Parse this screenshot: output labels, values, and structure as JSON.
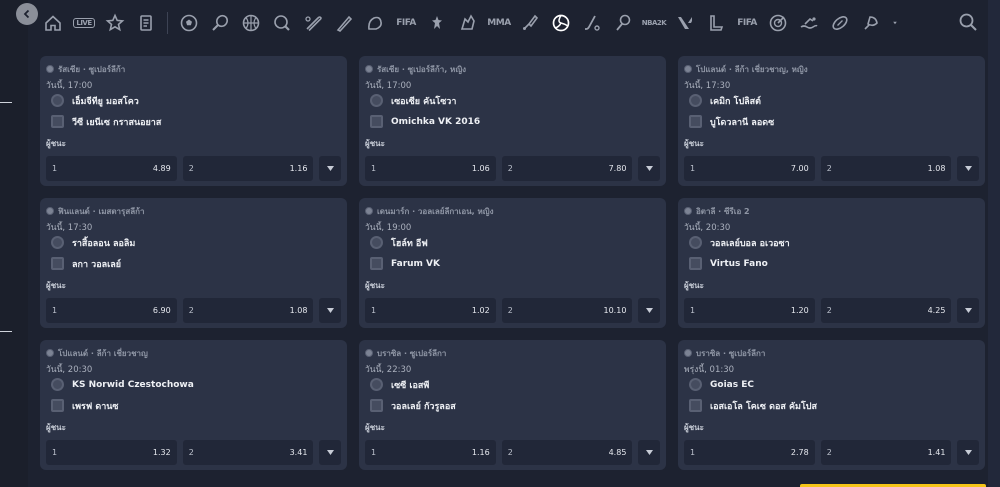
{
  "nav": {
    "sports": [
      {
        "name": "home-icon",
        "type": "svg"
      },
      {
        "name": "live-icon",
        "type": "text",
        "text": "LIVE"
      },
      {
        "name": "star-icon",
        "type": "svg"
      },
      {
        "name": "betslip-icon",
        "type": "svg"
      },
      {
        "name": "separator"
      },
      {
        "name": "soccer-icon",
        "type": "svg"
      },
      {
        "name": "tennis-icon",
        "type": "svg"
      },
      {
        "name": "basketball-icon",
        "type": "svg"
      },
      {
        "name": "pingpong-icon",
        "type": "svg"
      },
      {
        "name": "baseball-icon",
        "type": "svg"
      },
      {
        "name": "cricket-icon",
        "type": "svg"
      },
      {
        "name": "esports-icon",
        "type": "svg"
      },
      {
        "name": "fifa-icon",
        "type": "text",
        "text": "FIFA"
      },
      {
        "name": "counter-strike-icon",
        "type": "svg"
      },
      {
        "name": "dota-icon",
        "type": "svg"
      },
      {
        "name": "mma-icon",
        "type": "text",
        "text": "MMA"
      },
      {
        "name": "badminton-icon",
        "type": "svg"
      },
      {
        "name": "volleyball-icon",
        "type": "svg",
        "active": true
      },
      {
        "name": "hockey-icon",
        "type": "svg"
      },
      {
        "name": "handball-icon",
        "type": "svg"
      },
      {
        "name": "nba2k-icon",
        "type": "text",
        "text": "NBA2K"
      },
      {
        "name": "valorant-icon",
        "type": "svg"
      },
      {
        "name": "league-of-legends-icon",
        "type": "svg"
      },
      {
        "name": "volta-fifa-icon",
        "type": "text",
        "text": "FIFA"
      },
      {
        "name": "darts-icon",
        "type": "svg"
      },
      {
        "name": "swimming-icon",
        "type": "svg"
      },
      {
        "name": "rugby-icon",
        "type": "svg"
      },
      {
        "name": "more-sports-icon",
        "type": "svg"
      },
      {
        "name": "dropdown-caret-icon",
        "type": "svg"
      }
    ]
  },
  "matches": [
    {
      "league": "รัสเซีย · ซูเปอร์ลีก้า",
      "date": "วันนี้, 17:00",
      "team1": "เอ็มจีทียู มอสโคว",
      "team2": "วีซี เยนีเซ กราสนอยาส",
      "winner_label": "ผู้ชนะ",
      "odd1_label": "1",
      "odd1": "4.89",
      "odd2_label": "2",
      "odd2": "1.16"
    },
    {
      "league": "รัสเซีย · ซูเปอร์ลีก้า, หญิง",
      "date": "วันนี้, 17:00",
      "team1": "เซอเซีย คันโซวา",
      "team2": "Omichka VK 2016",
      "winner_label": "ผู้ชนะ",
      "odd1_label": "1",
      "odd1": "1.06",
      "odd2_label": "2",
      "odd2": "7.80"
    },
    {
      "league": "โปแลนด์ · ลีก้า เชี่ยวชาญ, หญิง",
      "date": "วันนี้, 17:30",
      "team1": "เคมิก โปลิสต์",
      "team2": "บูโดวลานี ลอดซ",
      "winner_label": "ผู้ชนะ",
      "odd1_label": "1",
      "odd1": "7.00",
      "odd2_label": "2",
      "odd2": "1.08"
    },
    {
      "league": "ฟินแลนด์ · เมสตารุสลีก้า",
      "date": "วันนี้, 17:30",
      "team1": "ราสิ้อลอน ลอลิม",
      "team2": "ลกา วอลเลย์",
      "winner_label": "ผู้ชนะ",
      "odd1_label": "1",
      "odd1": "6.90",
      "odd2_label": "2",
      "odd2": "1.08"
    },
    {
      "league": "เดนมาร์ก · วอลเลย์ลีกาเอน, หญิง",
      "date": "วันนี้, 19:00",
      "team1": "โฮล์ท อีฟ",
      "team2": "Farum VK",
      "winner_label": "ผู้ชนะ",
      "odd1_label": "1",
      "odd1": "1.02",
      "odd2_label": "2",
      "odd2": "10.10"
    },
    {
      "league": "อิตาลี · ซีรีเอ 2",
      "date": "วันนี้, 20:30",
      "team1": "วอลเลย์บอล อเวอซา",
      "team2": "Virtus Fano",
      "winner_label": "ผู้ชนะ",
      "odd1_label": "1",
      "odd1": "1.20",
      "odd2_label": "2",
      "odd2": "4.25"
    },
    {
      "league": "โปแลนด์ · ลีก้า เชี่ยวชาญ",
      "date": "วันนี้, 20:30",
      "team1": "KS Norwid Czestochowa",
      "team2": "เพรฟ ดานซ",
      "winner_label": "ผู้ชนะ",
      "odd1_label": "1",
      "odd1": "1.32",
      "odd2_label": "2",
      "odd2": "3.41"
    },
    {
      "league": "บราซิล · ซูเปอร์ลีกา",
      "date": "วันนี้, 22:30",
      "team1": "เซซี เอสพี",
      "team2": "วอลเลย์ กัวรูลอส",
      "winner_label": "ผู้ชนะ",
      "odd1_label": "1",
      "odd1": "1.16",
      "odd2_label": "2",
      "odd2": "4.85"
    },
    {
      "league": "บราซิล · ซูเปอร์ลีกา",
      "date": "พรุ่งนี้, 01:30",
      "team1": "Goias EC",
      "team2": "เอสเอโล โคเซ ดอส คัมโปส",
      "winner_label": "ผู้ชนะ",
      "odd1_label": "1",
      "odd1": "2.78",
      "odd2_label": "2",
      "odd2": "1.41"
    }
  ]
}
